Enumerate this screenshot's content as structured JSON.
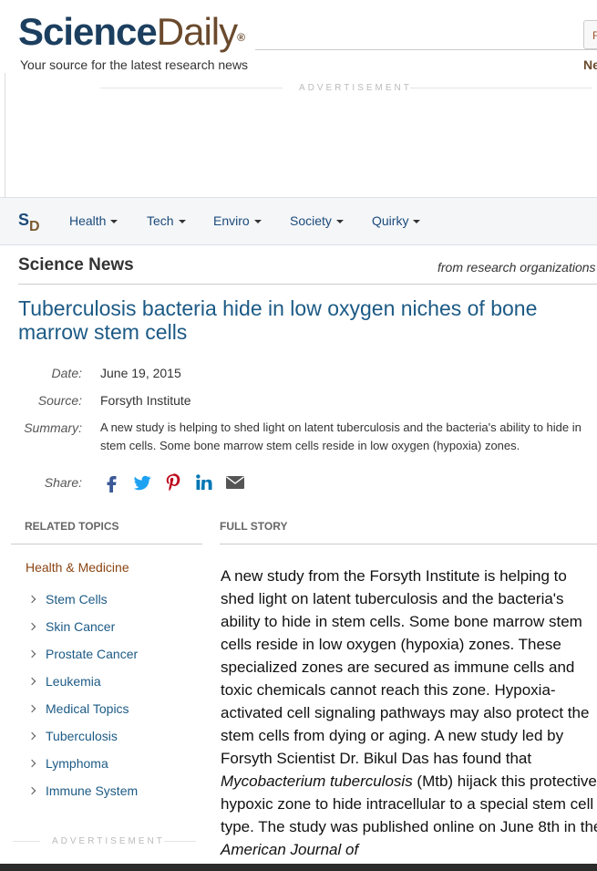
{
  "header": {
    "logo_part1": "Science",
    "logo_part2": "Daily",
    "logo_reg": "®",
    "tagline": "Your source for the latest research news",
    "top_box_text": "F",
    "top_right_text": "Ne"
  },
  "ads": {
    "label": "ADVERTISEMENT"
  },
  "nav": {
    "logo_s": "S",
    "logo_d": "D",
    "items": [
      {
        "label": "Health"
      },
      {
        "label": "Tech"
      },
      {
        "label": "Enviro"
      },
      {
        "label": "Society"
      },
      {
        "label": "Quirky"
      }
    ]
  },
  "section": {
    "title": "Science News",
    "subtitle": "from research organizations"
  },
  "article": {
    "headline": "Tuberculosis bacteria hide in low oxygen niches of bone marrow stem cells",
    "date_label": "Date:",
    "date": "June 19, 2015",
    "source_label": "Source:",
    "source": "Forsyth Institute",
    "summary_label": "Summary:",
    "summary": "A new study is helping to shed light on latent tuberculosis and the bacteria's ability to hide in stem cells. Some bone marrow stem cells reside in low oxygen (hypoxia) zones.",
    "share_label": "Share:",
    "share_icons": [
      "facebook-icon",
      "twitter-icon",
      "pinterest-icon",
      "linkedin-icon",
      "email-icon"
    ]
  },
  "related_topics": {
    "header": "RELATED TOPICS",
    "category": "Health & Medicine",
    "items": [
      "Stem Cells",
      "Skin Cancer",
      "Prostate Cancer",
      "Leukemia",
      "Medical Topics",
      "Tuberculosis",
      "Lymphoma",
      "Immune System"
    ]
  },
  "full_story": {
    "header": "FULL STORY",
    "p1_a": "A new study from the Forsyth Institute is helping to shed light on latent tuberculosis and the bacteria's ability to hide in stem cells. Some bone marrow stem cells reside in low oxygen (hypoxia) zones. These specialized zones are secured as immune cells and toxic chemicals cannot reach this zone. Hypoxia- activated cell signaling pathways may also protect the stem cells from dying or aging. A new study led by Forsyth Scientist Dr. Bikul Das has found that ",
    "p1_italic1": "Mycobacterium tuberculosis",
    "p1_b": " (Mtb) hijack this protective hypoxic zone to hide intracellular to a special stem cell type. The study was published online on June 8th in the ",
    "p1_italic2": "American Journal of"
  },
  "colors": {
    "brand_blue": "#1c3f5f",
    "brand_brown": "#6a4a2d",
    "link_blue": "#1c5a85",
    "category_brown": "#8b4513"
  }
}
